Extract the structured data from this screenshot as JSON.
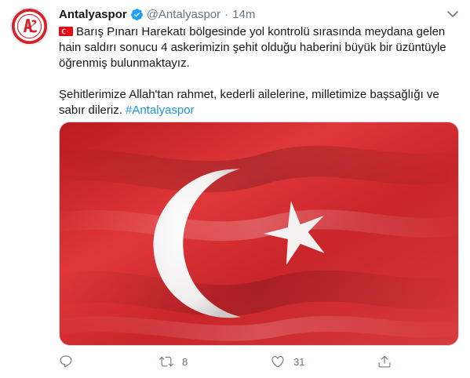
{
  "tweet": {
    "display_name": "Antalyaspor",
    "handle": "@Antalyaspor",
    "separator": "·",
    "time": "14m",
    "verified": true,
    "avatar_icon": "antalyaspor-logo",
    "text_para1": "Barış Pınarı Harekatı bölgesinde yol kontrolü sırasında meydana gelen hain saldırı sonucu 4 askerimizin şehit olduğu haberini büyük bir üzüntüyle öğrenmiş bulunmaktayız.",
    "text_para2": "Şehitlerimize Allah'tan rahmet, kederli ailelerine, milletimize başsağlığı ve sabır dileriz.",
    "hashtag": "#Antalyaspor",
    "flag_emoji_icon": "turkey-flag-emoji",
    "media_image": "turkish-flag"
  },
  "actions": {
    "reply_count": "",
    "retweet_count": "8",
    "like_count": "31"
  },
  "colors": {
    "link": "#1b95e0",
    "secondary_text": "#657786",
    "verified": "#1da1f2",
    "flag_red": "#d3262b"
  },
  "icons": [
    "chevron-down-icon",
    "verified-icon",
    "reply-icon",
    "retweet-icon",
    "like-icon",
    "share-icon"
  ]
}
